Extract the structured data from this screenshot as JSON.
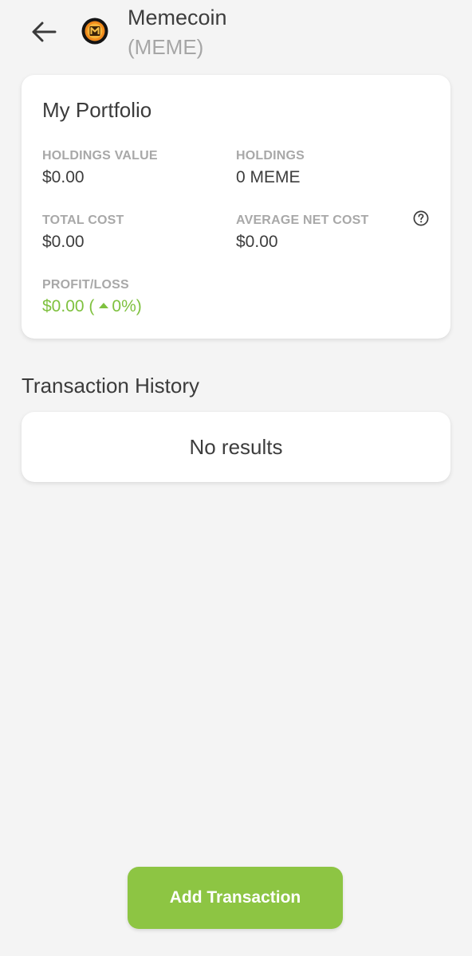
{
  "header": {
    "coin_name": "Memecoin",
    "coin_symbol": "(MEME)"
  },
  "portfolio": {
    "title": "My Portfolio",
    "holdings_value_label": "HOLDINGS VALUE",
    "holdings_value": "$0.00",
    "holdings_label": "HOLDINGS",
    "holdings": "0 MEME",
    "total_cost_label": "TOTAL COST",
    "total_cost": "$0.00",
    "average_net_cost_label": "AVERAGE NET COST",
    "average_net_cost": "$0.00",
    "profit_loss_label": "PROFIT/LOSS",
    "profit_loss_amount": "$0.00 (",
    "profit_loss_percent": "0%)"
  },
  "transactions": {
    "title": "Transaction History",
    "empty_text": "No results"
  },
  "actions": {
    "add_transaction_label": "Add Transaction"
  },
  "icons": {
    "back": "arrow-left-icon",
    "help": "question-circle-icon",
    "profit_direction": "triangle-up-icon",
    "coin": "memecoin-logo"
  },
  "colors": {
    "accent_green": "#8dc543",
    "profit_green": "#7fc13f",
    "muted_label": "#a8a8a8",
    "background": "#f4f4f4"
  }
}
